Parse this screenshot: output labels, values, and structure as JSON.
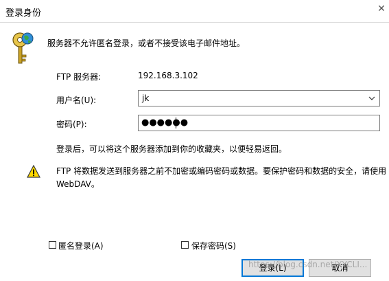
{
  "window": {
    "title": "登录身份",
    "close_glyph": "✕"
  },
  "message": "服务器不允许匿名登录，或者不接受该电子邮件地址。",
  "server": {
    "label": "FTP 服务器:",
    "value": "192.168.3.102"
  },
  "username": {
    "label": "用户名(U):",
    "value": "jk"
  },
  "password": {
    "label": "密码(P):",
    "masked_value": "●●●●●●"
  },
  "note": "登录后，可以将这个服务器添加到你的收藏夹，以便轻易返回。",
  "warning": {
    "line1": "FTP 将数据发送到服务器之前不加密或编码密码或数据。要保护密码和数据的安全，请使用",
    "line2": "WebDAV。"
  },
  "anonymous_checkbox": {
    "label": "匿名登录(A)",
    "checked": false
  },
  "save_password_checkbox": {
    "label": "保存密码(S)",
    "checked": false
  },
  "buttons": {
    "login": "登录(L)",
    "cancel": "取消"
  },
  "watermark": "https://blog.csdn.net/XYCLI...",
  "icons": {
    "keys": "keys-globe-icon",
    "warning": "warning-icon",
    "dropdown": "chevron-down-icon"
  },
  "colors": {
    "accent_border": "#0078d7",
    "warning_yellow": "#ffd800"
  }
}
